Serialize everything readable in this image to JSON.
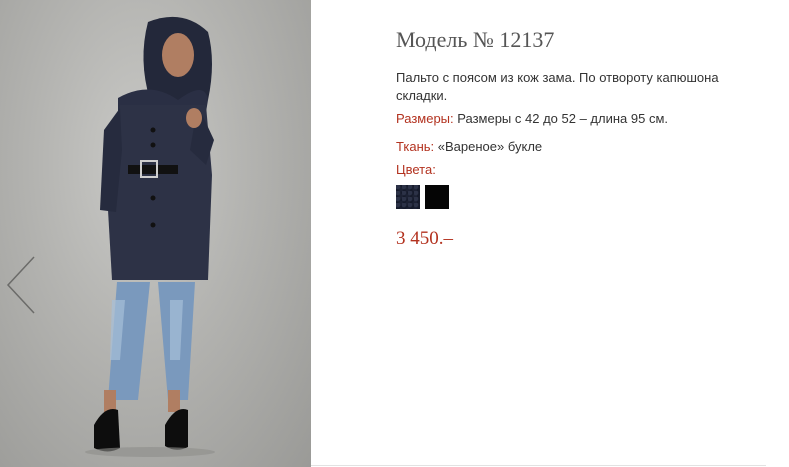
{
  "product": {
    "title": "Модель № 12137",
    "description": "Пальто с поясом из кож зама. По отвороту капюшона складки.",
    "sizes_label": "Размеры:",
    "sizes_value": " Размеры с 42 до 52 – длина 95 см.",
    "fabric_label": "Ткань:",
    "fabric_value": " «Вареное» букле",
    "colors_label": "Цвета:",
    "colors": [
      {
        "name": "navy-boucle",
        "hex": "#151a2a"
      },
      {
        "name": "black",
        "hex": "#050505"
      }
    ],
    "price": "3 450.–"
  },
  "gallery": {
    "prev_icon": "chevron-left-icon"
  },
  "theme": {
    "accent": "#b3321f",
    "title_color": "#555555",
    "text_color": "#333333",
    "photo_bg": "#b3b3b0"
  }
}
